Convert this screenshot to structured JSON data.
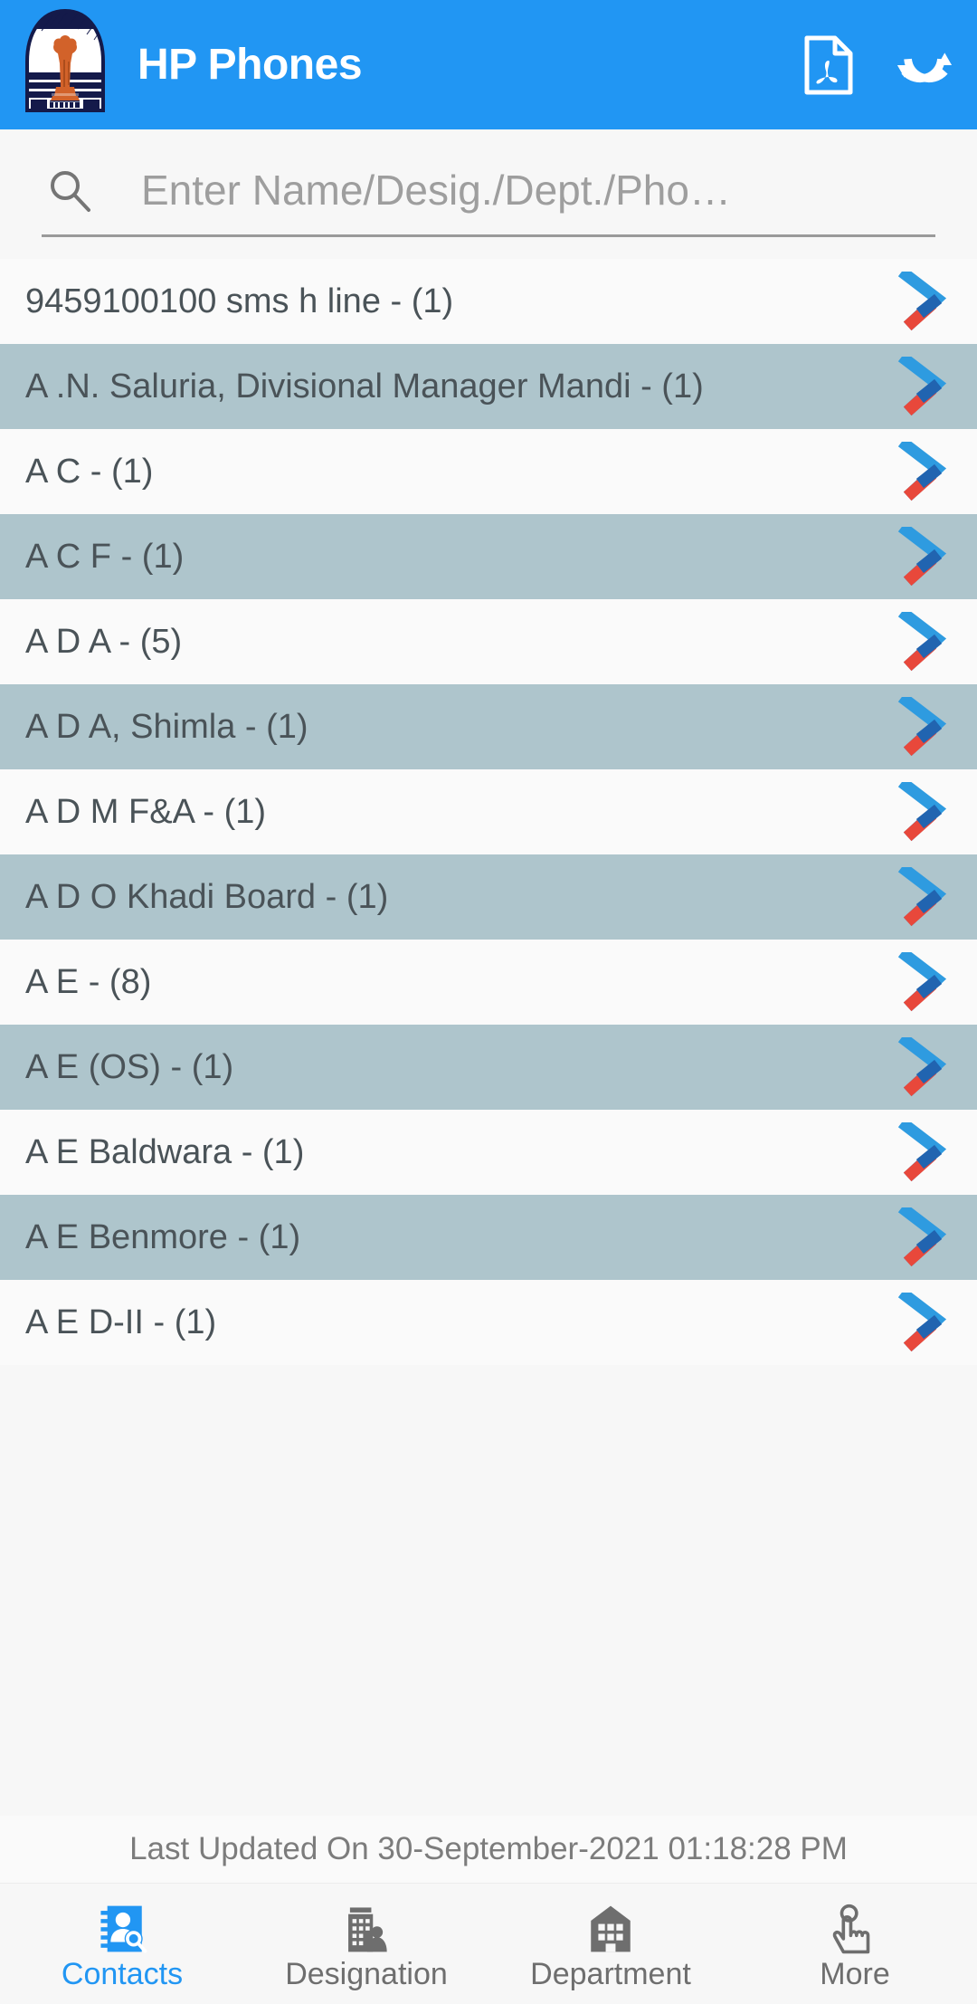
{
  "header": {
    "title": "HP Phones",
    "logo_alt": "himachal-pradesh-government-emblem",
    "pdf_label": "pdf-export",
    "sync_label": "sync"
  },
  "search": {
    "placeholder": "Enter Name/Desig./Dept./Pho…",
    "value": "",
    "icon": "search-icon"
  },
  "list": {
    "items": [
      {
        "label": "9459100100 sms h line - (1)"
      },
      {
        "label": "A .N. Saluria, Divisional Manager Mandi - (1)"
      },
      {
        "label": "A C - (1)"
      },
      {
        "label": "A C F - (1)"
      },
      {
        "label": "A D A - (5)"
      },
      {
        "label": "A D A, Shimla - (1)"
      },
      {
        "label": "A D M F&A - (1)"
      },
      {
        "label": "A D O Khadi Board - (1)"
      },
      {
        "label": "A E - (8)"
      },
      {
        "label": "A E (OS) - (1)"
      },
      {
        "label": "A E Baldwara - (1)"
      },
      {
        "label": "A E Benmore - (1)"
      },
      {
        "label": "A E D-II - (1)"
      }
    ]
  },
  "footer": {
    "last_updated": "Last Updated On 30-September-2021 01:18:28 PM"
  },
  "bottom_nav": {
    "items": [
      {
        "label": "Contacts",
        "icon": "contacts-book-search-icon",
        "active": true
      },
      {
        "label": "Designation",
        "icon": "office-person-icon",
        "active": false
      },
      {
        "label": "Department",
        "icon": "building-icon",
        "active": false
      },
      {
        "label": "More",
        "icon": "tap-hand-icon",
        "active": false
      }
    ]
  },
  "colors": {
    "accent": "#2196F3",
    "row_even": "#AEC5CC",
    "row_odd": "#FAFAFA",
    "chevron_blue": "#2E9BE0",
    "chevron_red": "#E8483B",
    "text": "#4A5358"
  }
}
